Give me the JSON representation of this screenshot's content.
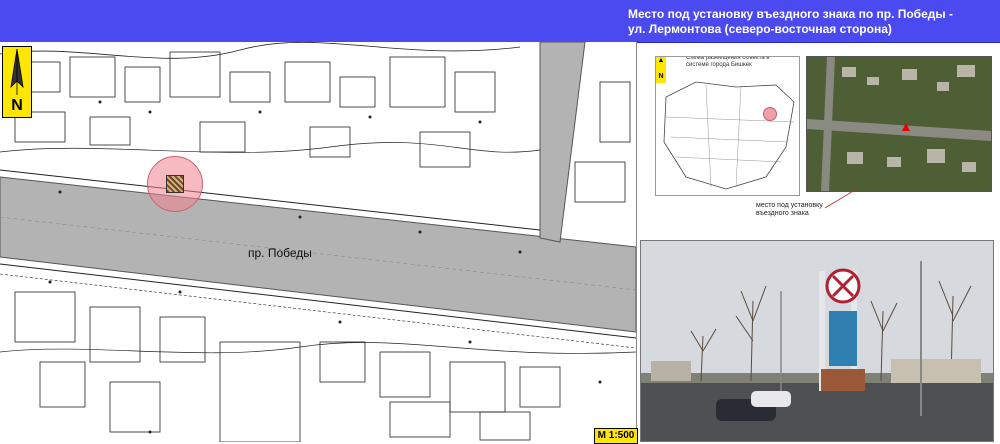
{
  "header": {
    "title_line1": "Место под установку въездного знака по пр. Победы -",
    "title_line2": "ул. Лермонтова (северо-восточная сторона)"
  },
  "main_map": {
    "north_label": "N",
    "street_label": "пр. Победы",
    "scale_label": "M 1:500"
  },
  "inset_city": {
    "north_label": "N",
    "caption": "Схема размещения объекта в системе города Бишкек"
  },
  "inset_photo_map": {
    "callout": "место под установку въездного знака"
  },
  "colors": {
    "header_bg": "#4a4af0",
    "road_fill": "#b3b3b3",
    "north_bg": "#ffe600",
    "location_circle": "#f0828c"
  }
}
